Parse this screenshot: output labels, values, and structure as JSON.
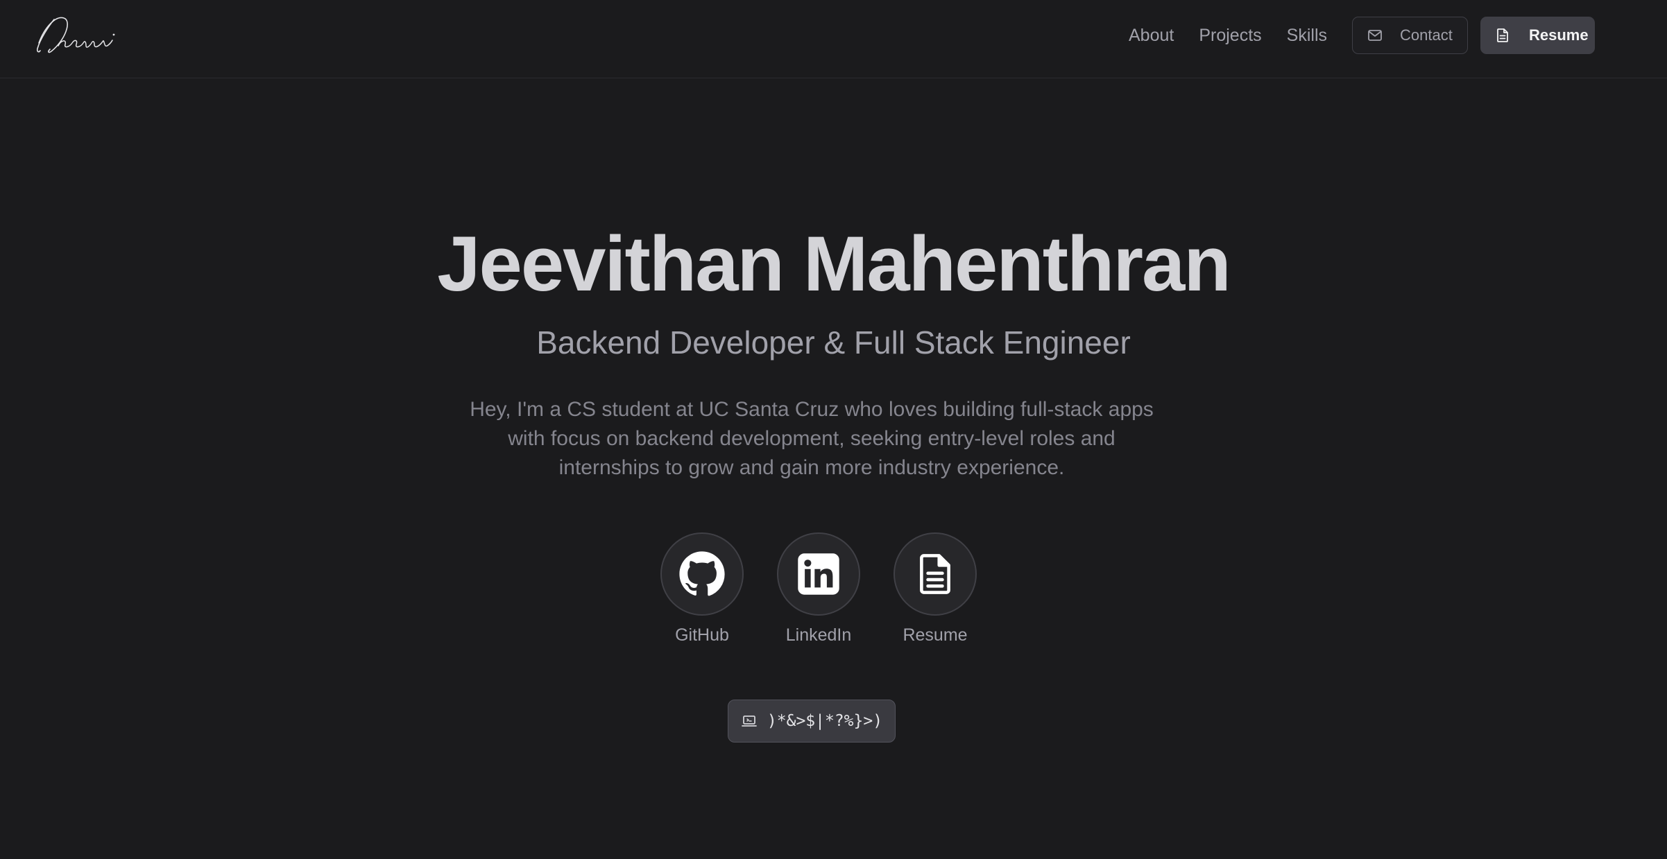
{
  "header": {
    "logo_text": "Jeevi",
    "nav": [
      {
        "label": "About"
      },
      {
        "label": "Projects"
      },
      {
        "label": "Skills"
      }
    ],
    "contact_button": {
      "label": "Contact",
      "icon": "mail-icon"
    },
    "resume_button": {
      "label": "Resume",
      "icon": "document-icon"
    }
  },
  "hero": {
    "name": "Jeevithan Mahenthran",
    "subtitle": "Backend Developer & Full Stack Engineer",
    "bio": "Hey, I'm a CS student at UC Santa Cruz who loves building full-stack apps with focus on backend development, seeking entry-level roles and internships to grow and gain more industry experience."
  },
  "socials": [
    {
      "label": "GitHub",
      "icon": "github-icon"
    },
    {
      "label": "LinkedIn",
      "icon": "linkedin-icon"
    },
    {
      "label": "Resume",
      "icon": "document-icon"
    }
  ],
  "badge": {
    "text": ")*&>$|*?%}>)",
    "icon": "laptop-icon"
  },
  "colors": {
    "background": "#1b1b1d",
    "text_primary": "#d4d4d8",
    "text_muted": "#a1a1aa",
    "accent_button": "#3f3f46"
  }
}
